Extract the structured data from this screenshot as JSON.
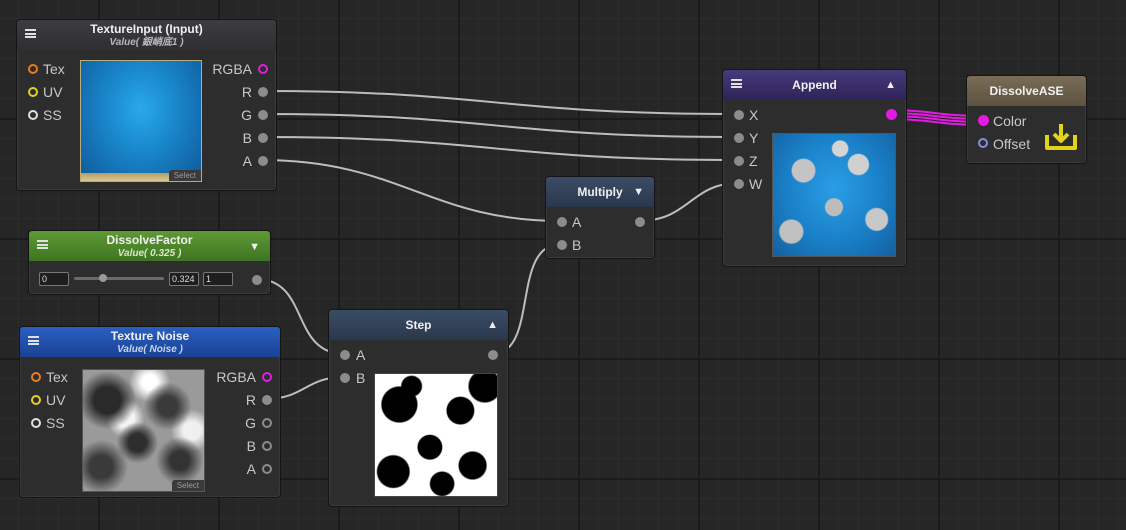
{
  "texture_input": {
    "title": "TextureInput (Input)",
    "subtitle": "Value( 銀峭底1 )",
    "inputs": [
      "Tex",
      "UV",
      "SS"
    ],
    "outputs": [
      "RGBA",
      "R",
      "G",
      "B",
      "A"
    ],
    "select_label": "Select"
  },
  "dissolve_factor": {
    "title": "DissolveFactor",
    "subtitle": "Value( 0.325 )",
    "min": "0",
    "value": "0.324",
    "max": "1",
    "slider_position": 0.325
  },
  "texture_noise": {
    "title": "Texture Noise",
    "subtitle": "Value( Noise )",
    "inputs": [
      "Tex",
      "UV",
      "SS"
    ],
    "outputs": [
      "RGBA",
      "R",
      "G",
      "B",
      "A"
    ],
    "select_label": "Select"
  },
  "step": {
    "title": "Step",
    "inputs": [
      "A",
      "B"
    ]
  },
  "multiply": {
    "title": "Multiply",
    "inputs": [
      "A",
      "B"
    ]
  },
  "append": {
    "title": "Append",
    "inputs": [
      "X",
      "Y",
      "Z",
      "W"
    ]
  },
  "dissolve_ase": {
    "title": "DissolveASE",
    "inputs": [
      "Color",
      "Offset"
    ]
  },
  "colors": {
    "tex_port": "#e87c1e",
    "uv_port": "#e2d21c",
    "ss_port": "#e0e0e0",
    "rgba_port": "#e01ce0",
    "offset_port": "#8a8ae8",
    "wire": "#bdbdbd",
    "wire_color": "#e01ce0",
    "dissolve_factor_header": "#4e8a2a",
    "texture_noise_header": "#1e4fa8",
    "texture_input_header": "#353539",
    "append_header": "#3a2e6a",
    "step_header": "#2e3e55",
    "multiply_header": "#2e3e55",
    "master_header": "#6e6250"
  },
  "icons": {
    "menu": "hamburger-icon",
    "collapse_up": "triangle-up-icon",
    "collapse_down": "triangle-down-icon",
    "master": "download-tray-icon"
  }
}
